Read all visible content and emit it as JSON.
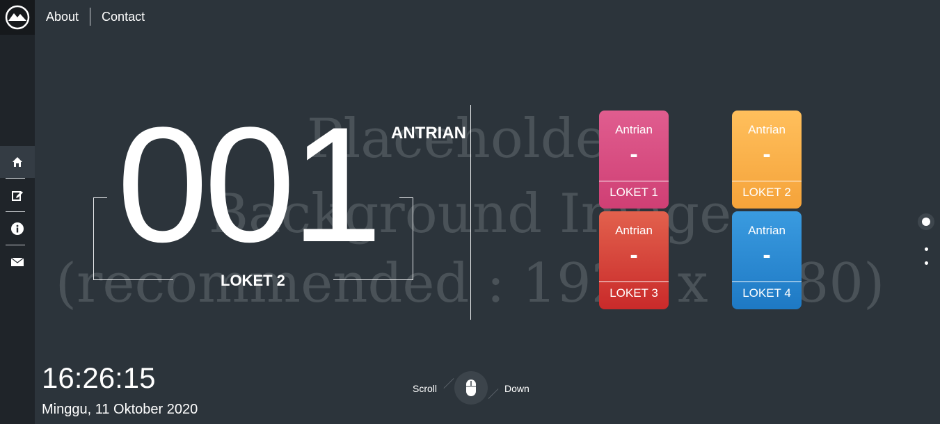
{
  "nav": {
    "about": "About",
    "contact": "Contact"
  },
  "sidebar": {
    "items": [
      {
        "icon": "home-icon",
        "active": true
      },
      {
        "icon": "edit-icon",
        "active": false
      },
      {
        "icon": "info-icon",
        "active": false
      },
      {
        "icon": "mail-icon",
        "active": false
      }
    ]
  },
  "placeholder": {
    "line1": "Placeholder",
    "line2": "Background Image",
    "line3": "(recommended : 1920 x 1080)"
  },
  "current": {
    "number": "001",
    "counter": "LOKET 2",
    "title": "ANTRIAN"
  },
  "counters": [
    {
      "title": "Antrian",
      "value": "-",
      "name": "LOKET 1",
      "color": "#d84a80"
    },
    {
      "title": "Antrian",
      "value": "-",
      "name": "LOKET 2",
      "color": "#fbb04a"
    },
    {
      "title": "Antrian",
      "value": "-",
      "name": "LOKET 3",
      "color": "#d5413a"
    },
    {
      "title": "Antrian",
      "value": "-",
      "name": "LOKET 4",
      "color": "#2b8ad2"
    }
  ],
  "clock": {
    "time": "16:26:15",
    "date": "Minggu, 11 Oktober 2020"
  },
  "scroll": {
    "left": "Scroll",
    "right": "Down"
  }
}
